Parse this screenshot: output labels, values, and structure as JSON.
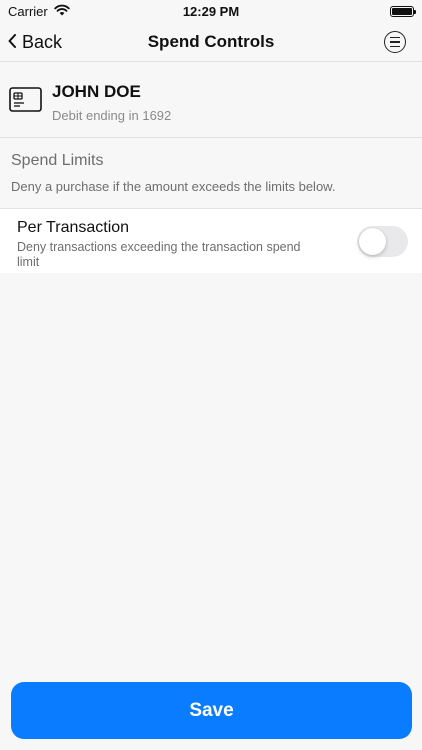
{
  "status_bar": {
    "carrier": "Carrier",
    "time": "12:29 PM",
    "icons": [
      "wifi-icon",
      "battery-icon"
    ]
  },
  "nav": {
    "back_label": "Back",
    "title": "Spend Controls",
    "menu_icon": "menu-circle-icon"
  },
  "card": {
    "icon": "credit-card-icon",
    "holder_name": "JOHN DOE",
    "subtitle": "Debit ending in 1692"
  },
  "spend_limits": {
    "title": "Spend Limits",
    "description": "Deny a purchase if the amount exceeds the limits below.",
    "items": [
      {
        "title": "Per Transaction",
        "description": "Deny transactions exceeding the transaction spend limit",
        "enabled": false
      }
    ]
  },
  "footer": {
    "save_label": "Save"
  },
  "colors": {
    "accent": "#0a7cff",
    "background": "#f7f7f7",
    "toggle_off": "#e9e9eb",
    "secondary_text": "#6e6e6e"
  }
}
